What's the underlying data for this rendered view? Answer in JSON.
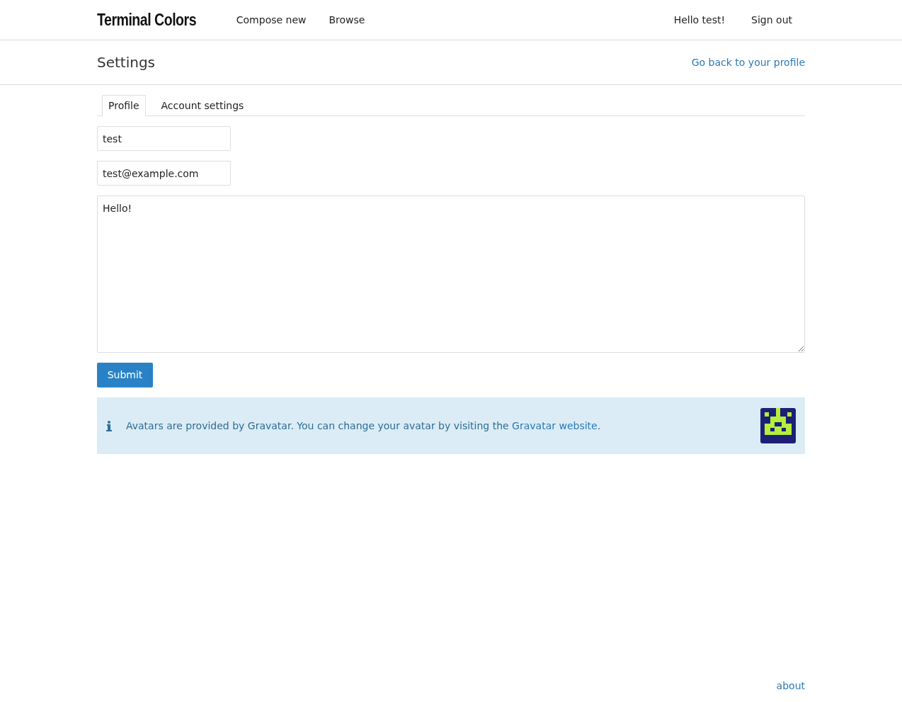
{
  "navbar": {
    "brand": "Terminal Colors",
    "links": [
      "Compose new",
      "Browse"
    ],
    "user_links": [
      "Hello test!",
      "Sign out"
    ]
  },
  "header": {
    "title": "Settings",
    "back_link": "Go back to your profile"
  },
  "tabs": [
    {
      "label": "Profile",
      "selected": true
    },
    {
      "label": "Account settings",
      "selected": false
    }
  ],
  "form": {
    "username": "test",
    "email": "test@example.com",
    "bio": "Hello!",
    "submit": "Submit"
  },
  "notice": {
    "text": "Avatars are provided by Gravatar. You can change your avatar by visiting the ",
    "link": "Gravatar website",
    "text_after": "."
  },
  "footer": {
    "link": "about"
  }
}
